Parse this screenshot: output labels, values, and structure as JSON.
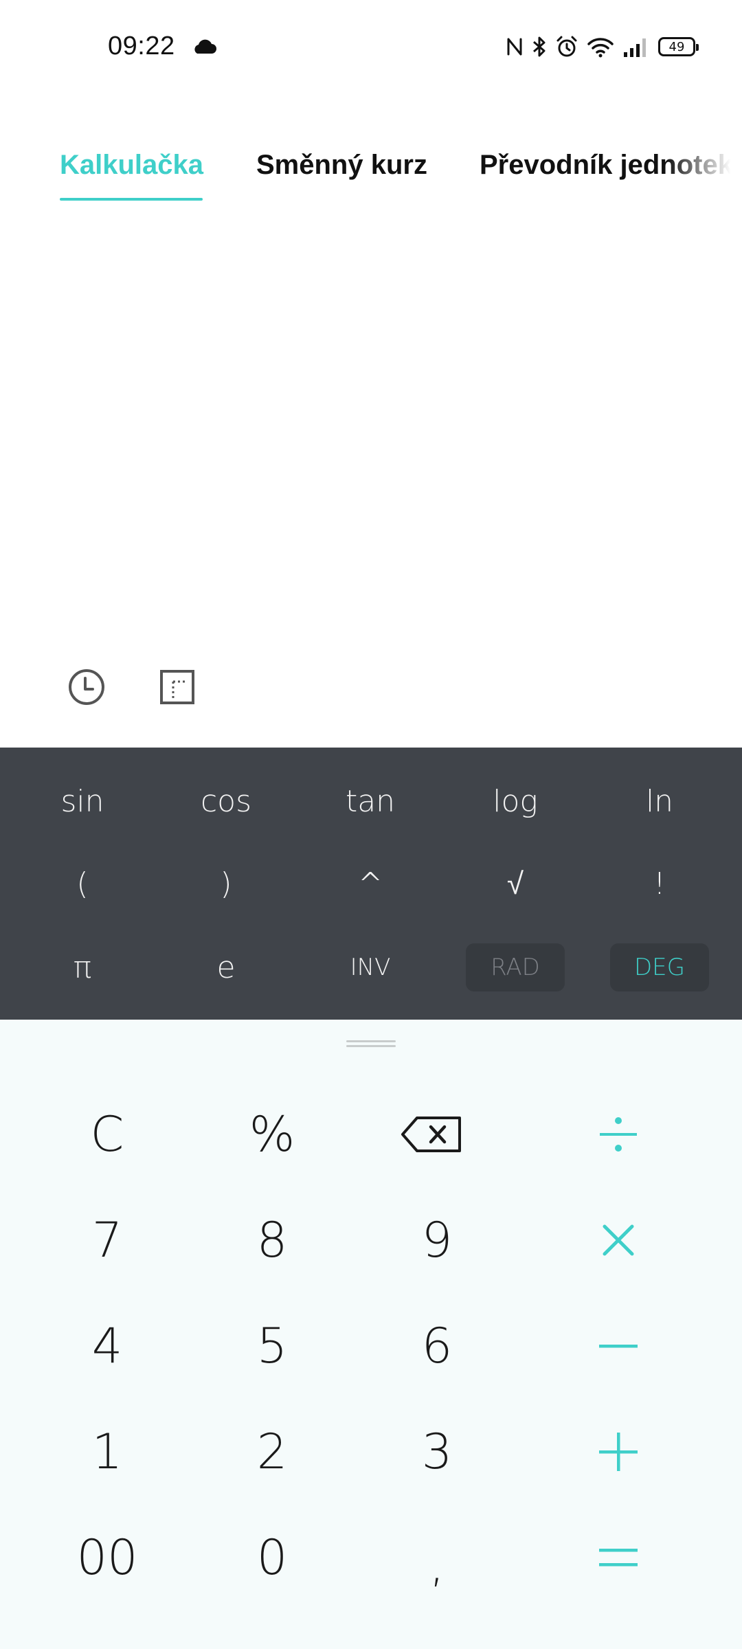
{
  "status_bar": {
    "time": "09:22",
    "battery": "49",
    "icons": [
      "cloud-icon",
      "nfc-icon",
      "bluetooth-icon",
      "alarm-icon",
      "wifi-icon",
      "signal-icon",
      "battery-icon"
    ]
  },
  "tabs": [
    {
      "label": "Kalkulačka",
      "active": true
    },
    {
      "label": "Směnný kurz",
      "active": false
    },
    {
      "label": "Převodník jednotek",
      "active": false
    }
  ],
  "tools": [
    "history-icon",
    "ruler-icon"
  ],
  "scientific": {
    "row1": [
      "sin",
      "cos",
      "tan",
      "log",
      "ln"
    ],
    "row2": [
      "(",
      ")",
      "^",
      "√",
      "!"
    ],
    "row3": [
      "π",
      "e",
      "INV",
      "RAD",
      "DEG"
    ],
    "angle_mode": "DEG"
  },
  "keypad": {
    "clear": "C",
    "percent": "%",
    "backspace_icon": "backspace-icon",
    "divide_icon": "divide-icon",
    "digits_row1": [
      "7",
      "8",
      "9"
    ],
    "multiply_icon": "multiply-icon",
    "digits_row2": [
      "4",
      "5",
      "6"
    ],
    "minus_icon": "minus-icon",
    "digits_row3": [
      "1",
      "2",
      "3"
    ],
    "plus_icon": "plus-icon",
    "double_zero": "00",
    "zero": "0",
    "decimal": ",",
    "equals_icon": "equals-icon"
  },
  "colors": {
    "accent": "#3fcfc9",
    "panel": "#40444a",
    "keypad_bg": "#f5fbfb"
  }
}
